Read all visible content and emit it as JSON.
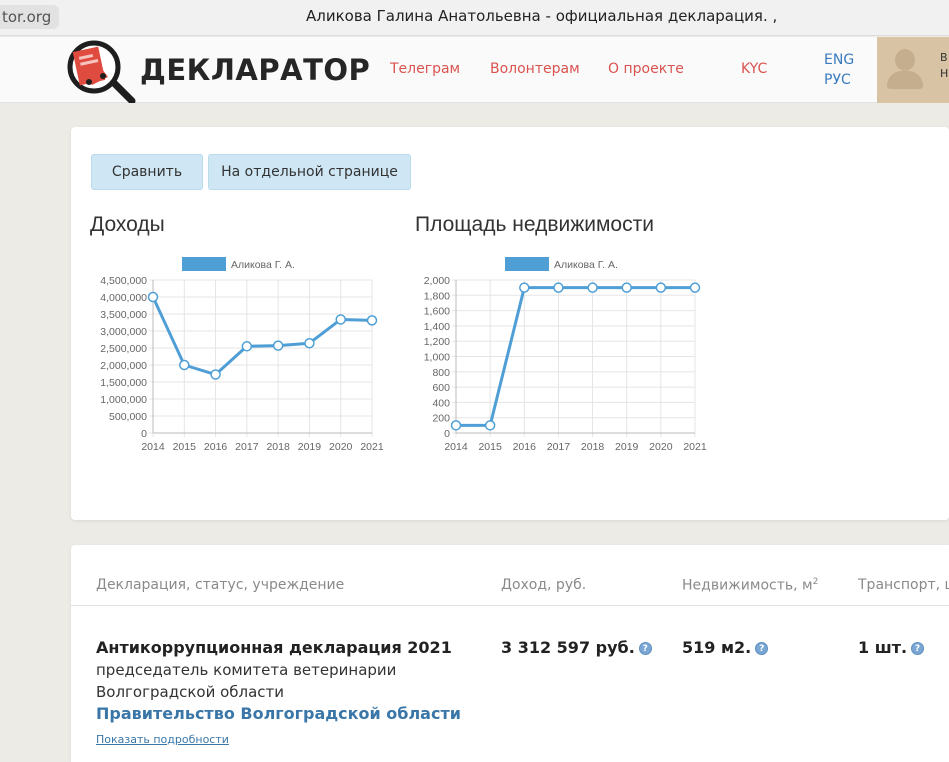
{
  "browser": {
    "url_fragment": "tor.org",
    "window_title": "Аликова Галина Анатольевна - официальная декларация. ,"
  },
  "header": {
    "logo_text": "ДЕКЛАРАТОР",
    "nav": [
      "Телеграм",
      "Волонтерам",
      "О проекте",
      "KYC"
    ],
    "languages": [
      "ENG",
      "РУС"
    ],
    "user_text": [
      "В",
      "Н"
    ]
  },
  "toolbar": {
    "compare_label": "Сравнить",
    "separate_page_label": "На отдельной странице"
  },
  "colors": {
    "accent": "#4f9fd6",
    "nav_link": "#d9534f",
    "link": "#3a77a8"
  },
  "chart_data": [
    {
      "type": "line",
      "title": "Доходы",
      "legend": "Аликова Г. А.",
      "legend_position": "top",
      "categories": [
        "2014",
        "2015",
        "2016",
        "2017",
        "2018",
        "2019",
        "2020",
        "2021"
      ],
      "series": [
        {
          "name": "Аликова Г. А.",
          "values": [
            4000000,
            2000000,
            1720000,
            2550000,
            2570000,
            2640000,
            3340000,
            3312597
          ]
        }
      ],
      "ylim": [
        0,
        4500000
      ],
      "yticks": [
        "4,500,000",
        "4,000,000",
        "3,500,000",
        "3,000,000",
        "2,500,000",
        "2,000,000",
        "1,500,000",
        "1,000,000",
        "500,000",
        "0"
      ],
      "grid": true
    },
    {
      "type": "line",
      "title": "Площадь недвижимости",
      "legend": "Аликова Г. А.",
      "legend_position": "top",
      "categories": [
        "2014",
        "2015",
        "2016",
        "2017",
        "2018",
        "2019",
        "2020",
        "2021"
      ],
      "series": [
        {
          "name": "Аликова Г. А.",
          "values": [
            100,
            100,
            1900,
            1900,
            1900,
            1900,
            1900,
            1900
          ]
        }
      ],
      "ylim": [
        0,
        2000
      ],
      "yticks": [
        "2,000",
        "1,800",
        "1,600",
        "1,400",
        "1,200",
        "1,000",
        "800",
        "600",
        "400",
        "200",
        "0"
      ],
      "grid": true
    }
  ],
  "table": {
    "headers": [
      "Декларация, статус, учреждение",
      "Доход, руб.",
      "Недвижимость, м",
      "Транспорт, ш"
    ],
    "header_sup": "2",
    "row": {
      "title": "Антикоррупционная декларация 2021",
      "position_line1": "председатель комитета ветеринарии",
      "position_line2": "Волгоградской области",
      "organization": "Правительство Волгоградской области",
      "details_link": "Показать подробности",
      "income": "3 312 597 руб.",
      "realty": "519 м2.",
      "transport": "1 шт.",
      "help_icon_glyph": "?"
    }
  }
}
